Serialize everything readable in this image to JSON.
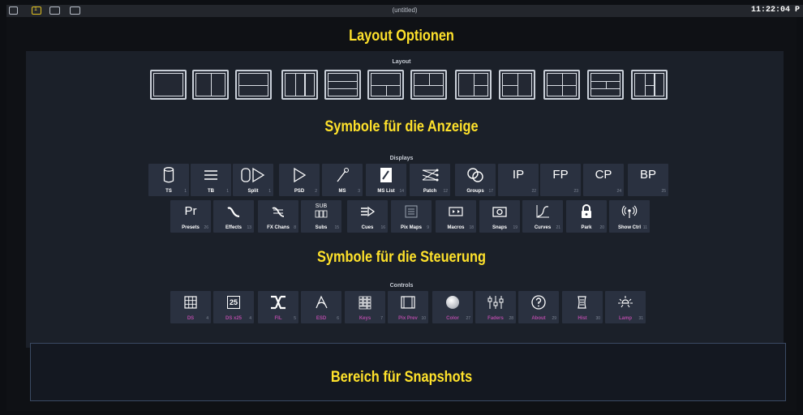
{
  "topbar": {
    "title": "(untitled)",
    "clock": "11:22:04 P",
    "badge": "1",
    "icons": [
      "monitor-icon",
      "workspace-1-icon",
      "workspace-2-icon",
      "workspace-3-icon"
    ]
  },
  "headings": {
    "layout": "Layout Optionen",
    "displays": "Symbole für die Anzeige",
    "controls": "Symbole für die Steuerung",
    "snapshots": "Bereich für Snapshots"
  },
  "sections": {
    "layout": "Layout",
    "displays": "Displays",
    "controls": "Controls"
  },
  "display_tiles_row1": [
    {
      "label": "TS",
      "num": "1",
      "icon": "cylinder-icon"
    },
    {
      "label": "TB",
      "num": "1",
      "icon": "lines-icon"
    },
    {
      "label": "Split",
      "num": "1",
      "icon": "split-icon"
    },
    {
      "label": "PSD",
      "num": "2",
      "icon": "play-outline-icon"
    },
    {
      "label": "MS",
      "num": "3",
      "icon": "magic-wand-icon"
    },
    {
      "label": "MS List",
      "num": "14",
      "icon": "list-doc-icon"
    },
    {
      "label": "Patch",
      "num": "12",
      "icon": "patch-icon"
    },
    {
      "label": "Groups",
      "num": "17",
      "icon": "groups-icon"
    },
    {
      "label": "",
      "num": "22",
      "icon": "ip-text",
      "glyph": "IP"
    },
    {
      "label": "",
      "num": "23",
      "icon": "fp-text",
      "glyph": "FP"
    },
    {
      "label": "",
      "num": "24",
      "icon": "cp-text",
      "glyph": "CP"
    },
    {
      "label": "",
      "num": "25",
      "icon": "bp-text",
      "glyph": "BP"
    }
  ],
  "display_tiles_row2": [
    {
      "label": "Presets",
      "num": "26",
      "icon": "pr-text",
      "glyph": "Pr"
    },
    {
      "label": "Effects",
      "num": "13",
      "icon": "wave-icon"
    },
    {
      "label": "FX Chans",
      "num": "8",
      "icon": "fx-chans-icon"
    },
    {
      "label": "Subs",
      "num": "15",
      "icon": "subs-icon",
      "glyph": "SUB"
    },
    {
      "label": "Cues",
      "num": "16",
      "icon": "cues-icon"
    },
    {
      "label": "Pix Maps",
      "num": "9",
      "icon": "pixmap-icon"
    },
    {
      "label": "Macros",
      "num": "18",
      "icon": "macros-icon"
    },
    {
      "label": "Snaps",
      "num": "19",
      "icon": "snaps-icon"
    },
    {
      "label": "Curves",
      "num": "21",
      "icon": "curves-icon"
    },
    {
      "label": "Park",
      "num": "20",
      "icon": "lock-icon"
    },
    {
      "label": "Show Ctrl",
      "num": "11",
      "icon": "broadcast-icon"
    }
  ],
  "control_tiles": [
    {
      "label": "DS",
      "num": "4",
      "icon": "grid-icon"
    },
    {
      "label": "DS x25",
      "num": "4",
      "icon": "grid25-icon",
      "glyph": "25"
    },
    {
      "label": "FIL",
      "num": "5",
      "icon": "fader-x-icon"
    },
    {
      "label": "ESD",
      "num": "6",
      "icon": "encoder-icon"
    },
    {
      "label": "Keys",
      "num": "7",
      "icon": "keypad-icon"
    },
    {
      "label": "Pix Prev",
      "num": "10",
      "icon": "film-icon"
    },
    {
      "label": "Color",
      "num": "27",
      "icon": "color-ball-icon"
    },
    {
      "label": "Faders",
      "num": "28",
      "icon": "faders-icon"
    },
    {
      "label": "About",
      "num": "29",
      "icon": "question-icon"
    },
    {
      "label": "Hist",
      "num": "30",
      "icon": "scroll-icon"
    },
    {
      "label": "Lamp",
      "num": "31",
      "icon": "lamp-icon"
    }
  ],
  "colors": {
    "heading": "#ffe22b",
    "tile_bg": "#2a3140",
    "workspace_bg": "#1b2029",
    "control_label": "#b14aa4"
  }
}
